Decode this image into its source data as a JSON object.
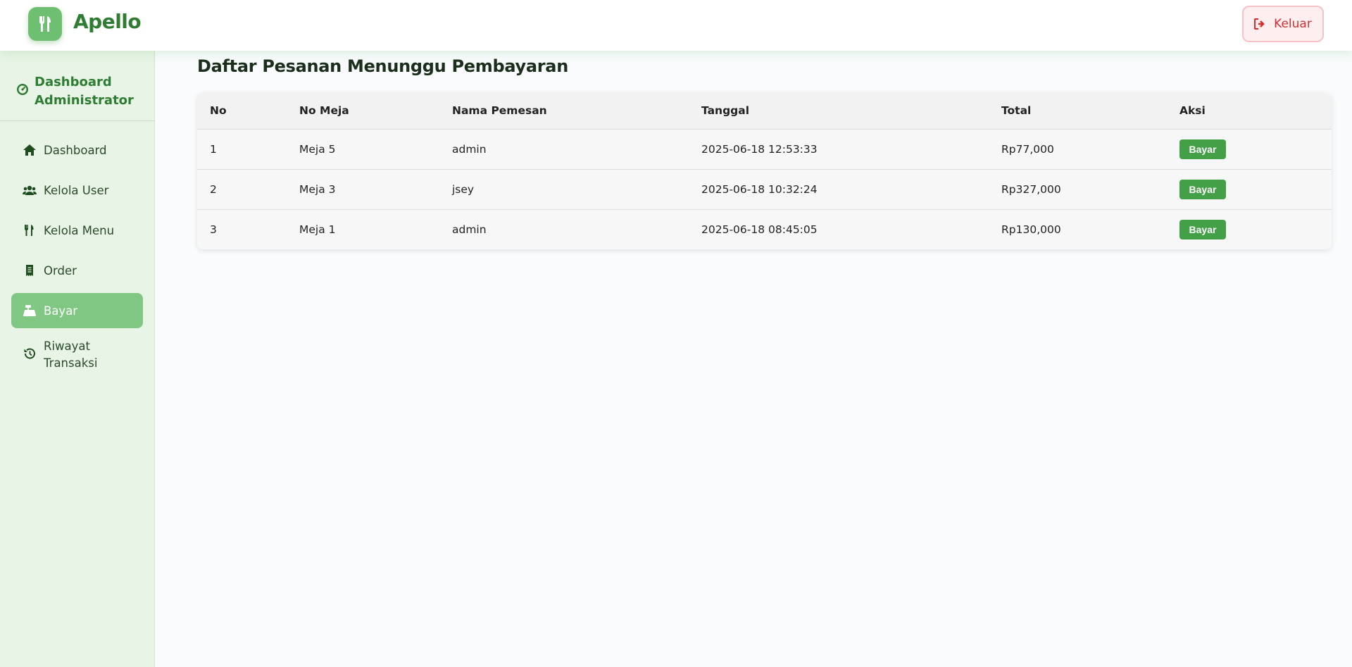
{
  "app": {
    "brand": "Apello"
  },
  "header": {
    "logout_label": "Keluar"
  },
  "sidebar": {
    "title": "Dashboard Administrator",
    "items": [
      {
        "label": "Dashboard",
        "icon": "home-icon"
      },
      {
        "label": "Kelola User",
        "icon": "users-icon"
      },
      {
        "label": "Kelola Menu",
        "icon": "utensils-icon"
      },
      {
        "label": "Order",
        "icon": "receipt-icon"
      },
      {
        "label": "Bayar",
        "icon": "cash-register-icon",
        "active": true
      },
      {
        "label": "Riwayat Transaksi",
        "icon": "history-icon"
      }
    ]
  },
  "main": {
    "title": "Daftar Pesanan Menunggu Pembayaran",
    "table": {
      "columns": [
        "No",
        "No Meja",
        "Nama Pemesan",
        "Tanggal",
        "Total",
        "Aksi"
      ],
      "rows": [
        {
          "no": "1",
          "meja": "Meja 5",
          "nama": "admin",
          "tanggal": "2025-06-18 12:53:33",
          "total": "Rp77,000",
          "aksi": "Bayar"
        },
        {
          "no": "2",
          "meja": "Meja 3",
          "nama": "jsey",
          "tanggal": "2025-06-18 10:32:24",
          "total": "Rp327,000",
          "aksi": "Bayar"
        },
        {
          "no": "3",
          "meja": "Meja 1",
          "nama": "admin",
          "tanggal": "2025-06-18 08:45:05",
          "total": "Rp130,000",
          "aksi": "Bayar"
        }
      ]
    }
  },
  "colors": {
    "brand": "#2e7d32",
    "accent": "#43a047",
    "active_nav": "#81c784",
    "logout": "#d32f2f"
  }
}
